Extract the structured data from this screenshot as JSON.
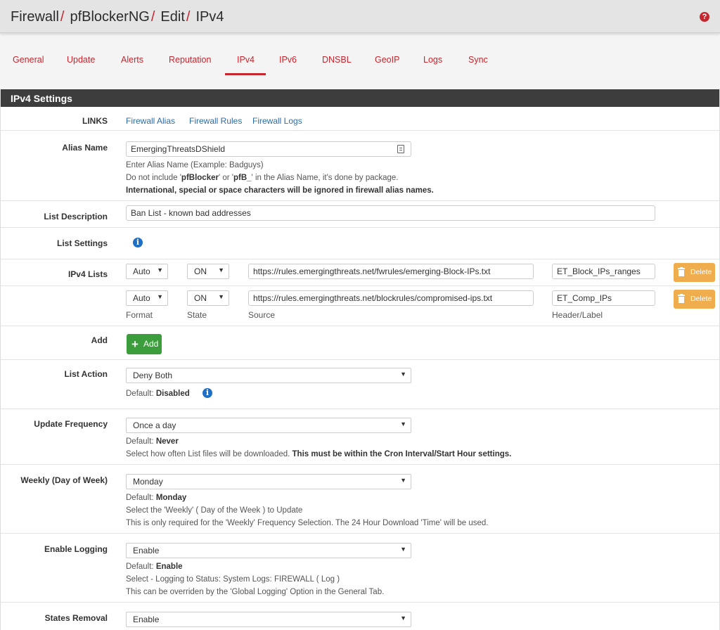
{
  "breadcrumb": {
    "items": [
      "Firewall",
      "pfBlockerNG",
      "Edit",
      "IPv4"
    ],
    "separator": "/"
  },
  "tabs": [
    "General",
    "Update",
    "Alerts",
    "Reputation",
    "IPv4",
    "IPv6",
    "DNSBL",
    "GeoIP",
    "Logs",
    "Sync"
  ],
  "active_tab": "IPv4",
  "panel": {
    "title": "IPv4 Settings"
  },
  "links": {
    "label": "LINKS",
    "items": [
      "Firewall Alias",
      "Firewall Rules",
      "Firewall Logs"
    ]
  },
  "alias_name": {
    "label": "Alias Name",
    "value": "EmergingThreatsDShield",
    "help1": "Enter Alias Name (Example: Badguys)",
    "help2_pre": "Do not include '",
    "help2_b1": "pfBlocker",
    "help2_mid1": "' or '",
    "help2_b2": "pfB_",
    "help2_post": "' in the Alias Name, it's done by package.",
    "help3": "International, special or space characters will be ignored in firewall alias names."
  },
  "list_description": {
    "label": "List Description",
    "value": "Ban List - known bad addresses"
  },
  "list_settings": {
    "label": "List Settings"
  },
  "ipv4_lists": {
    "label": "IPv4 Lists",
    "rows": [
      {
        "format": "Auto",
        "state": "ON",
        "source": "https://rules.emergingthreats.net/fwrules/emerging-Block-IPs.txt",
        "header": "ET_Block_IPs_ranges",
        "delete": "Delete"
      },
      {
        "format": "Auto",
        "state": "ON",
        "source": "https://rules.emergingthreats.net/blockrules/compromised-ips.txt",
        "header": "ET_Comp_IPs",
        "delete": "Delete"
      }
    ],
    "col_labels": {
      "format": "Format",
      "state": "State",
      "source": "Source",
      "header": "Header/Label"
    }
  },
  "add": {
    "label": "Add",
    "button": "Add"
  },
  "list_action": {
    "label": "List Action",
    "value": "Deny Both",
    "default_pre": "Default: ",
    "default_val": "Disabled"
  },
  "update_frequency": {
    "label": "Update Frequency",
    "value": "Once a day",
    "default_pre": "Default: ",
    "default_val": "Never",
    "help_pre": "Select how often List files will be downloaded. ",
    "help_bold": "This must be within the Cron Interval/Start Hour settings."
  },
  "weekly": {
    "label": "Weekly (Day of Week)",
    "value": "Monday",
    "default_pre": "Default: ",
    "default_val": "Monday",
    "help1": "Select the 'Weekly' ( Day of the Week ) to Update",
    "help2": "This is only required for the 'Weekly' Frequency Selection. The 24 Hour Download 'Time' will be used."
  },
  "enable_logging": {
    "label": "Enable Logging",
    "value": "Enable",
    "default_pre": "Default: ",
    "default_val": "Enable",
    "help1": "Select - Logging to Status: System Logs: FIREWALL ( Log )",
    "help2": "This can be overriden by the 'Global Logging' Option in the General Tab."
  },
  "states_removal": {
    "label": "States Removal",
    "value": "Enable"
  },
  "colors": {
    "accent": "#c6262e",
    "link": "#2e6da4",
    "warning": "#f0ad4e",
    "success": "#3b9d3b",
    "info": "#1f6fc5",
    "panel_head": "#3d3d3d"
  },
  "icons": [
    "help-icon",
    "info-icon",
    "trash-icon",
    "plus-icon",
    "caret-down-icon",
    "document-icon"
  ]
}
